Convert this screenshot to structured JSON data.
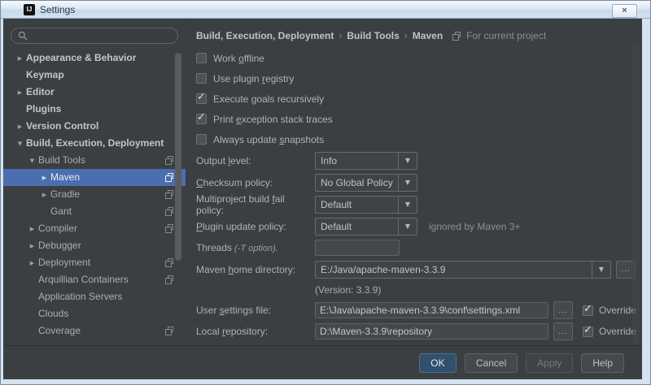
{
  "window": {
    "title": "Settings"
  },
  "icons": {
    "app_logo": "IJ",
    "close": "×",
    "tree_collapsed": "▶",
    "tree_expanded": "▼",
    "combo_arrow": "▼",
    "check": "✓",
    "browse": "...",
    "search": "magnifier",
    "shared_settings": "overlapping-squares"
  },
  "search": {
    "value": "",
    "placeholder": ""
  },
  "sidebar": {
    "items": [
      {
        "label": "Appearance & Behavior"
      },
      {
        "label": "Keymap"
      },
      {
        "label": "Editor"
      },
      {
        "label": "Plugins"
      },
      {
        "label": "Version Control"
      },
      {
        "label": "Build, Execution, Deployment"
      },
      {
        "label": "Build Tools"
      },
      {
        "label": "Maven"
      },
      {
        "label": "Gradle"
      },
      {
        "label": "Gant"
      },
      {
        "label": "Compiler"
      },
      {
        "label": "Debugger"
      },
      {
        "label": "Deployment"
      },
      {
        "label": "Arquillian Containers"
      },
      {
        "label": "Application Servers"
      },
      {
        "label": "Clouds"
      },
      {
        "label": "Coverage"
      }
    ]
  },
  "breadcrumb": {
    "segments": [
      "Build, Execution, Deployment",
      "Build Tools",
      "Maven"
    ],
    "separator": "›",
    "context": "For current project"
  },
  "main": {
    "checkboxes": [
      {
        "label": "Work &offline",
        "checked": false
      },
      {
        "label": "Use plugin &registry",
        "checked": false
      },
      {
        "label": "Execute &goals recursively",
        "checked": true
      },
      {
        "label": "Print &exception stack traces",
        "checked": true
      },
      {
        "label": "Always update &snapshots",
        "checked": false
      }
    ],
    "selects": [
      {
        "label": "Output &level:",
        "value": "Info",
        "note": ""
      },
      {
        "label": "&Checksum policy:",
        "value": "No Global Policy",
        "note": ""
      },
      {
        "label": "Multiproject build &fail policy:",
        "value": "Default",
        "note": ""
      },
      {
        "label": "&Plugin update policy:",
        "value": "Default",
        "note": "ignored by Maven 3+"
      }
    ],
    "threads": {
      "label": "Threads",
      "hint": "(-T option).",
      "value": ""
    },
    "maven_home": {
      "label": "Maven &home directory:",
      "value": "E:/Java/apache-maven-3.3.9",
      "version_note": "(Version: 3.3.9)"
    },
    "paths": [
      {
        "label": "User &settings file:",
        "value": "E:\\Java\\apache-maven-3.3.9\\conf\\settings.xml",
        "override": true,
        "override_label": "Override"
      },
      {
        "label": "Local &repository:",
        "value": "D:\\Maven-3.3.9\\repository",
        "override": true,
        "override_label": "Override"
      }
    ]
  },
  "footer": {
    "buttons": [
      {
        "label": "OK",
        "kind": "primary"
      },
      {
        "label": "Cancel",
        "kind": "normal"
      },
      {
        "label": "Apply",
        "kind": "disabled"
      },
      {
        "label": "Help",
        "kind": "normal"
      }
    ]
  }
}
